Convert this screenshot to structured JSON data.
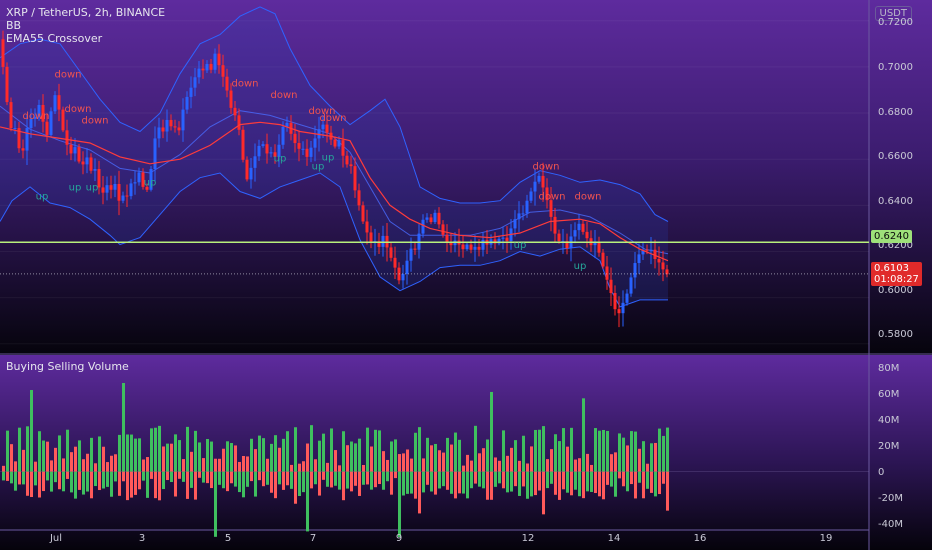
{
  "header": {
    "symbol_line": "XRP / TetherUS, 2h, BINANCE",
    "indicators": [
      "BB",
      "EMA55 Crossover"
    ],
    "currency": "USDT"
  },
  "volume_pane": {
    "title": "Buying Selling Volume"
  },
  "price_axis": {
    "ticks": [
      "0.7200",
      "0.7000",
      "0.6800",
      "0.6600",
      "0.6400",
      "0.6200",
      "0.6000",
      "0.5800"
    ]
  },
  "volume_axis": {
    "ticks": [
      "80M",
      "60M",
      "40M",
      "20M",
      "0",
      "-20M",
      "-40M"
    ]
  },
  "time_axis": {
    "ticks": [
      "Jul",
      "3",
      "5",
      "7",
      "9",
      "12",
      "14",
      "16",
      "19"
    ]
  },
  "levels": {
    "horizontal_line": "0.6240",
    "last_price": "0.6103",
    "countdown": "01:08:27"
  },
  "signals": {
    "up_label": "up",
    "down_label": "down"
  },
  "colors": {
    "up": "#26a69a",
    "down": "#ef5350",
    "bull_candle": "#2962ff",
    "bear_candle": "#ff2a2a",
    "bb_band": "#2f62ff",
    "ema": "#ff3b3b",
    "level_line": "#b8f07c",
    "vol_buy": "#3fbf5f",
    "vol_sell": "#ff5a5a"
  },
  "chart_data": {
    "type": "candlestick",
    "title": "XRP / TetherUS, 2h, BINANCE",
    "y_range": [
      0.576,
      0.729
    ],
    "volume_range": [
      -40,
      80
    ],
    "volume_units": "M",
    "price_path": [
      [
        0,
        0.712
      ],
      [
        4,
        0.696
      ],
      [
        8,
        0.681
      ],
      [
        12,
        0.671
      ],
      [
        14,
        0.676
      ],
      [
        18,
        0.666
      ],
      [
        22,
        0.661
      ],
      [
        26,
        0.672
      ],
      [
        30,
        0.678
      ],
      [
        34,
        0.676
      ],
      [
        38,
        0.685
      ],
      [
        42,
        0.679
      ],
      [
        46,
        0.668
      ],
      [
        50,
        0.678
      ],
      [
        54,
        0.689
      ],
      [
        58,
        0.684
      ],
      [
        62,
        0.674
      ],
      [
        66,
        0.668
      ],
      [
        70,
        0.661
      ],
      [
        74,
        0.667
      ],
      [
        78,
        0.66
      ],
      [
        82,
        0.656
      ],
      [
        86,
        0.663
      ],
      [
        90,
        0.654
      ],
      [
        94,
        0.658
      ],
      [
        98,
        0.649
      ],
      [
        102,
        0.644
      ],
      [
        106,
        0.65
      ],
      [
        110,
        0.645
      ],
      [
        114,
        0.652
      ],
      [
        118,
        0.641
      ],
      [
        122,
        0.645
      ],
      [
        126,
        0.642
      ],
      [
        130,
        0.65
      ],
      [
        134,
        0.648
      ],
      [
        138,
        0.656
      ],
      [
        142,
        0.649
      ],
      [
        146,
        0.645
      ],
      [
        150,
        0.652
      ],
      [
        154,
        0.667
      ],
      [
        158,
        0.675
      ],
      [
        162,
        0.67
      ],
      [
        166,
        0.678
      ],
      [
        170,
        0.674
      ],
      [
        174,
        0.675
      ],
      [
        178,
        0.67
      ],
      [
        182,
        0.68
      ],
      [
        186,
        0.686
      ],
      [
        190,
        0.69
      ],
      [
        194,
        0.694
      ],
      [
        198,
        0.7
      ],
      [
        202,
        0.697
      ],
      [
        206,
        0.703
      ],
      [
        210,
        0.696
      ],
      [
        214,
        0.707
      ],
      [
        218,
        0.702
      ],
      [
        222,
        0.697
      ],
      [
        226,
        0.692
      ],
      [
        230,
        0.683
      ],
      [
        234,
        0.68
      ],
      [
        238,
        0.676
      ],
      [
        242,
        0.663
      ],
      [
        246,
        0.65
      ],
      [
        250,
        0.655
      ],
      [
        254,
        0.66
      ],
      [
        258,
        0.665
      ],
      [
        262,
        0.668
      ],
      [
        266,
        0.662
      ],
      [
        270,
        0.664
      ],
      [
        274,
        0.66
      ],
      [
        278,
        0.664
      ],
      [
        282,
        0.673
      ],
      [
        286,
        0.677
      ],
      [
        290,
        0.672
      ],
      [
        294,
        0.668
      ],
      [
        298,
        0.664
      ],
      [
        302,
        0.666
      ],
      [
        306,
        0.66
      ],
      [
        310,
        0.664
      ],
      [
        314,
        0.668
      ],
      [
        318,
        0.672
      ],
      [
        322,
        0.676
      ],
      [
        326,
        0.672
      ],
      [
        330,
        0.67
      ],
      [
        334,
        0.664
      ],
      [
        338,
        0.67
      ],
      [
        342,
        0.663
      ],
      [
        346,
        0.657
      ],
      [
        350,
        0.66
      ],
      [
        354,
        0.648
      ],
      [
        358,
        0.642
      ],
      [
        362,
        0.634
      ],
      [
        366,
        0.63
      ],
      [
        370,
        0.623
      ],
      [
        374,
        0.626
      ],
      [
        378,
        0.62
      ],
      [
        382,
        0.628
      ],
      [
        386,
        0.623
      ],
      [
        390,
        0.618
      ],
      [
        394,
        0.615
      ],
      [
        398,
        0.607
      ],
      [
        402,
        0.609
      ],
      [
        406,
        0.614
      ],
      [
        410,
        0.622
      ],
      [
        414,
        0.619
      ],
      [
        418,
        0.626
      ],
      [
        422,
        0.633
      ],
      [
        426,
        0.636
      ],
      [
        430,
        0.631
      ],
      [
        434,
        0.638
      ],
      [
        438,
        0.633
      ],
      [
        442,
        0.628
      ],
      [
        446,
        0.625
      ],
      [
        450,
        0.622
      ],
      [
        454,
        0.625
      ],
      [
        458,
        0.624
      ],
      [
        462,
        0.62
      ],
      [
        466,
        0.624
      ],
      [
        470,
        0.62
      ],
      [
        474,
        0.623
      ],
      [
        478,
        0.619
      ],
      [
        482,
        0.626
      ],
      [
        486,
        0.622
      ],
      [
        490,
        0.626
      ],
      [
        494,
        0.623
      ],
      [
        498,
        0.625
      ],
      [
        502,
        0.627
      ],
      [
        506,
        0.623
      ],
      [
        510,
        0.629
      ],
      [
        514,
        0.633
      ],
      [
        518,
        0.637
      ],
      [
        522,
        0.635
      ],
      [
        526,
        0.641
      ],
      [
        530,
        0.645
      ],
      [
        534,
        0.649
      ],
      [
        538,
        0.654
      ],
      [
        542,
        0.649
      ],
      [
        546,
        0.644
      ],
      [
        550,
        0.637
      ],
      [
        554,
        0.629
      ],
      [
        558,
        0.624
      ],
      [
        562,
        0.626
      ],
      [
        566,
        0.62
      ],
      [
        570,
        0.626
      ],
      [
        574,
        0.628
      ],
      [
        578,
        0.633
      ],
      [
        582,
        0.629
      ],
      [
        586,
        0.627
      ],
      [
        590,
        0.622
      ],
      [
        594,
        0.625
      ],
      [
        598,
        0.621
      ],
      [
        602,
        0.615
      ],
      [
        606,
        0.609
      ],
      [
        610,
        0.604
      ],
      [
        614,
        0.596
      ],
      [
        618,
        0.592
      ],
      [
        622,
        0.597
      ],
      [
        626,
        0.6
      ],
      [
        630,
        0.607
      ],
      [
        634,
        0.614
      ],
      [
        638,
        0.618
      ],
      [
        642,
        0.621
      ],
      [
        646,
        0.62
      ],
      [
        650,
        0.622
      ],
      [
        654,
        0.617
      ],
      [
        658,
        0.616
      ],
      [
        662,
        0.613
      ],
      [
        666,
        0.61
      ],
      [
        668,
        0.6103
      ]
    ],
    "ema55_path": [
      [
        0,
        0.674
      ],
      [
        30,
        0.671
      ],
      [
        60,
        0.669
      ],
      [
        90,
        0.667
      ],
      [
        120,
        0.661
      ],
      [
        150,
        0.658
      ],
      [
        180,
        0.66
      ],
      [
        210,
        0.666
      ],
      [
        240,
        0.675
      ],
      [
        260,
        0.676
      ],
      [
        280,
        0.675
      ],
      [
        300,
        0.672
      ],
      [
        330,
        0.67
      ],
      [
        350,
        0.668
      ],
      [
        370,
        0.652
      ],
      [
        390,
        0.64
      ],
      [
        410,
        0.634
      ],
      [
        430,
        0.63
      ],
      [
        460,
        0.627
      ],
      [
        490,
        0.626
      ],
      [
        520,
        0.628
      ],
      [
        550,
        0.633
      ],
      [
        580,
        0.634
      ],
      [
        600,
        0.632
      ],
      [
        620,
        0.626
      ],
      [
        640,
        0.621
      ],
      [
        668,
        0.616
      ]
    ],
    "bb_upper_path": [
      [
        0,
        0.704
      ],
      [
        20,
        0.71
      ],
      [
        40,
        0.712
      ],
      [
        60,
        0.71
      ],
      [
        80,
        0.698
      ],
      [
        100,
        0.686
      ],
      [
        120,
        0.676
      ],
      [
        140,
        0.672
      ],
      [
        160,
        0.68
      ],
      [
        180,
        0.697
      ],
      [
        200,
        0.71
      ],
      [
        220,
        0.714
      ],
      [
        240,
        0.722
      ],
      [
        260,
        0.726
      ],
      [
        275,
        0.723
      ],
      [
        290,
        0.708
      ],
      [
        310,
        0.692
      ],
      [
        330,
        0.683
      ],
      [
        350,
        0.675
      ],
      [
        370,
        0.681
      ],
      [
        385,
        0.686
      ],
      [
        400,
        0.674
      ],
      [
        420,
        0.648
      ],
      [
        440,
        0.643
      ],
      [
        460,
        0.641
      ],
      [
        480,
        0.641
      ],
      [
        500,
        0.642
      ],
      [
        520,
        0.65
      ],
      [
        540,
        0.655
      ],
      [
        560,
        0.653
      ],
      [
        580,
        0.65
      ],
      [
        600,
        0.651
      ],
      [
        620,
        0.649
      ],
      [
        640,
        0.645
      ],
      [
        655,
        0.636
      ],
      [
        668,
        0.633
      ]
    ],
    "bb_basis_path": [
      [
        0,
        0.683
      ],
      [
        30,
        0.673
      ],
      [
        60,
        0.668
      ],
      [
        90,
        0.664
      ],
      [
        120,
        0.656
      ],
      [
        150,
        0.654
      ],
      [
        180,
        0.662
      ],
      [
        210,
        0.674
      ],
      [
        240,
        0.681
      ],
      [
        270,
        0.679
      ],
      [
        300,
        0.675
      ],
      [
        330,
        0.671
      ],
      [
        350,
        0.663
      ],
      [
        370,
        0.648
      ],
      [
        390,
        0.633
      ],
      [
        410,
        0.627
      ],
      [
        440,
        0.627
      ],
      [
        470,
        0.627
      ],
      [
        500,
        0.63
      ],
      [
        530,
        0.637
      ],
      [
        560,
        0.638
      ],
      [
        590,
        0.635
      ],
      [
        620,
        0.628
      ],
      [
        645,
        0.621
      ],
      [
        668,
        0.619
      ]
    ],
    "bb_lower_path": [
      [
        0,
        0.633
      ],
      [
        12,
        0.642
      ],
      [
        30,
        0.648
      ],
      [
        50,
        0.641
      ],
      [
        70,
        0.639
      ],
      [
        90,
        0.634
      ],
      [
        110,
        0.627
      ],
      [
        120,
        0.623
      ],
      [
        140,
        0.626
      ],
      [
        160,
        0.636
      ],
      [
        180,
        0.646
      ],
      [
        200,
        0.652
      ],
      [
        220,
        0.654
      ],
      [
        240,
        0.646
      ],
      [
        260,
        0.643
      ],
      [
        280,
        0.648
      ],
      [
        300,
        0.651
      ],
      [
        320,
        0.654
      ],
      [
        340,
        0.648
      ],
      [
        360,
        0.625
      ],
      [
        380,
        0.609
      ],
      [
        400,
        0.603
      ],
      [
        420,
        0.607
      ],
      [
        440,
        0.613
      ],
      [
        460,
        0.614
      ],
      [
        480,
        0.614
      ],
      [
        500,
        0.616
      ],
      [
        520,
        0.62
      ],
      [
        540,
        0.618
      ],
      [
        560,
        0.621
      ],
      [
        580,
        0.622
      ],
      [
        600,
        0.616
      ],
      [
        610,
        0.604
      ],
      [
        620,
        0.596
      ],
      [
        640,
        0.599
      ],
      [
        668,
        0.599
      ]
    ],
    "signal_markers": [
      {
        "x": 36,
        "price": 0.6775,
        "label": "down"
      },
      {
        "x": 68,
        "price": 0.6955,
        "label": "down"
      },
      {
        "x": 78,
        "price": 0.6805,
        "label": "down"
      },
      {
        "x": 95,
        "price": 0.6755,
        "label": "down"
      },
      {
        "x": 245,
        "price": 0.6915,
        "label": "down"
      },
      {
        "x": 284,
        "price": 0.6865,
        "label": "down"
      },
      {
        "x": 322,
        "price": 0.6795,
        "label": "down"
      },
      {
        "x": 333,
        "price": 0.6765,
        "label": "down"
      },
      {
        "x": 546,
        "price": 0.6555,
        "label": "down"
      },
      {
        "x": 552,
        "price": 0.6425,
        "label": "down"
      },
      {
        "x": 588,
        "price": 0.6425,
        "label": "down"
      },
      {
        "x": 42,
        "price": 0.6425,
        "label": "up"
      },
      {
        "x": 75,
        "price": 0.6465,
        "label": "up"
      },
      {
        "x": 92,
        "price": 0.6465,
        "label": "up"
      },
      {
        "x": 150,
        "price": 0.6485,
        "label": "up"
      },
      {
        "x": 280,
        "price": 0.659,
        "label": "up"
      },
      {
        "x": 318,
        "price": 0.6555,
        "label": "up"
      },
      {
        "x": 328,
        "price": 0.6595,
        "label": "up"
      },
      {
        "x": 520,
        "price": 0.6215,
        "label": "up"
      },
      {
        "x": 580,
        "price": 0.6125,
        "label": "up"
      }
    ]
  }
}
